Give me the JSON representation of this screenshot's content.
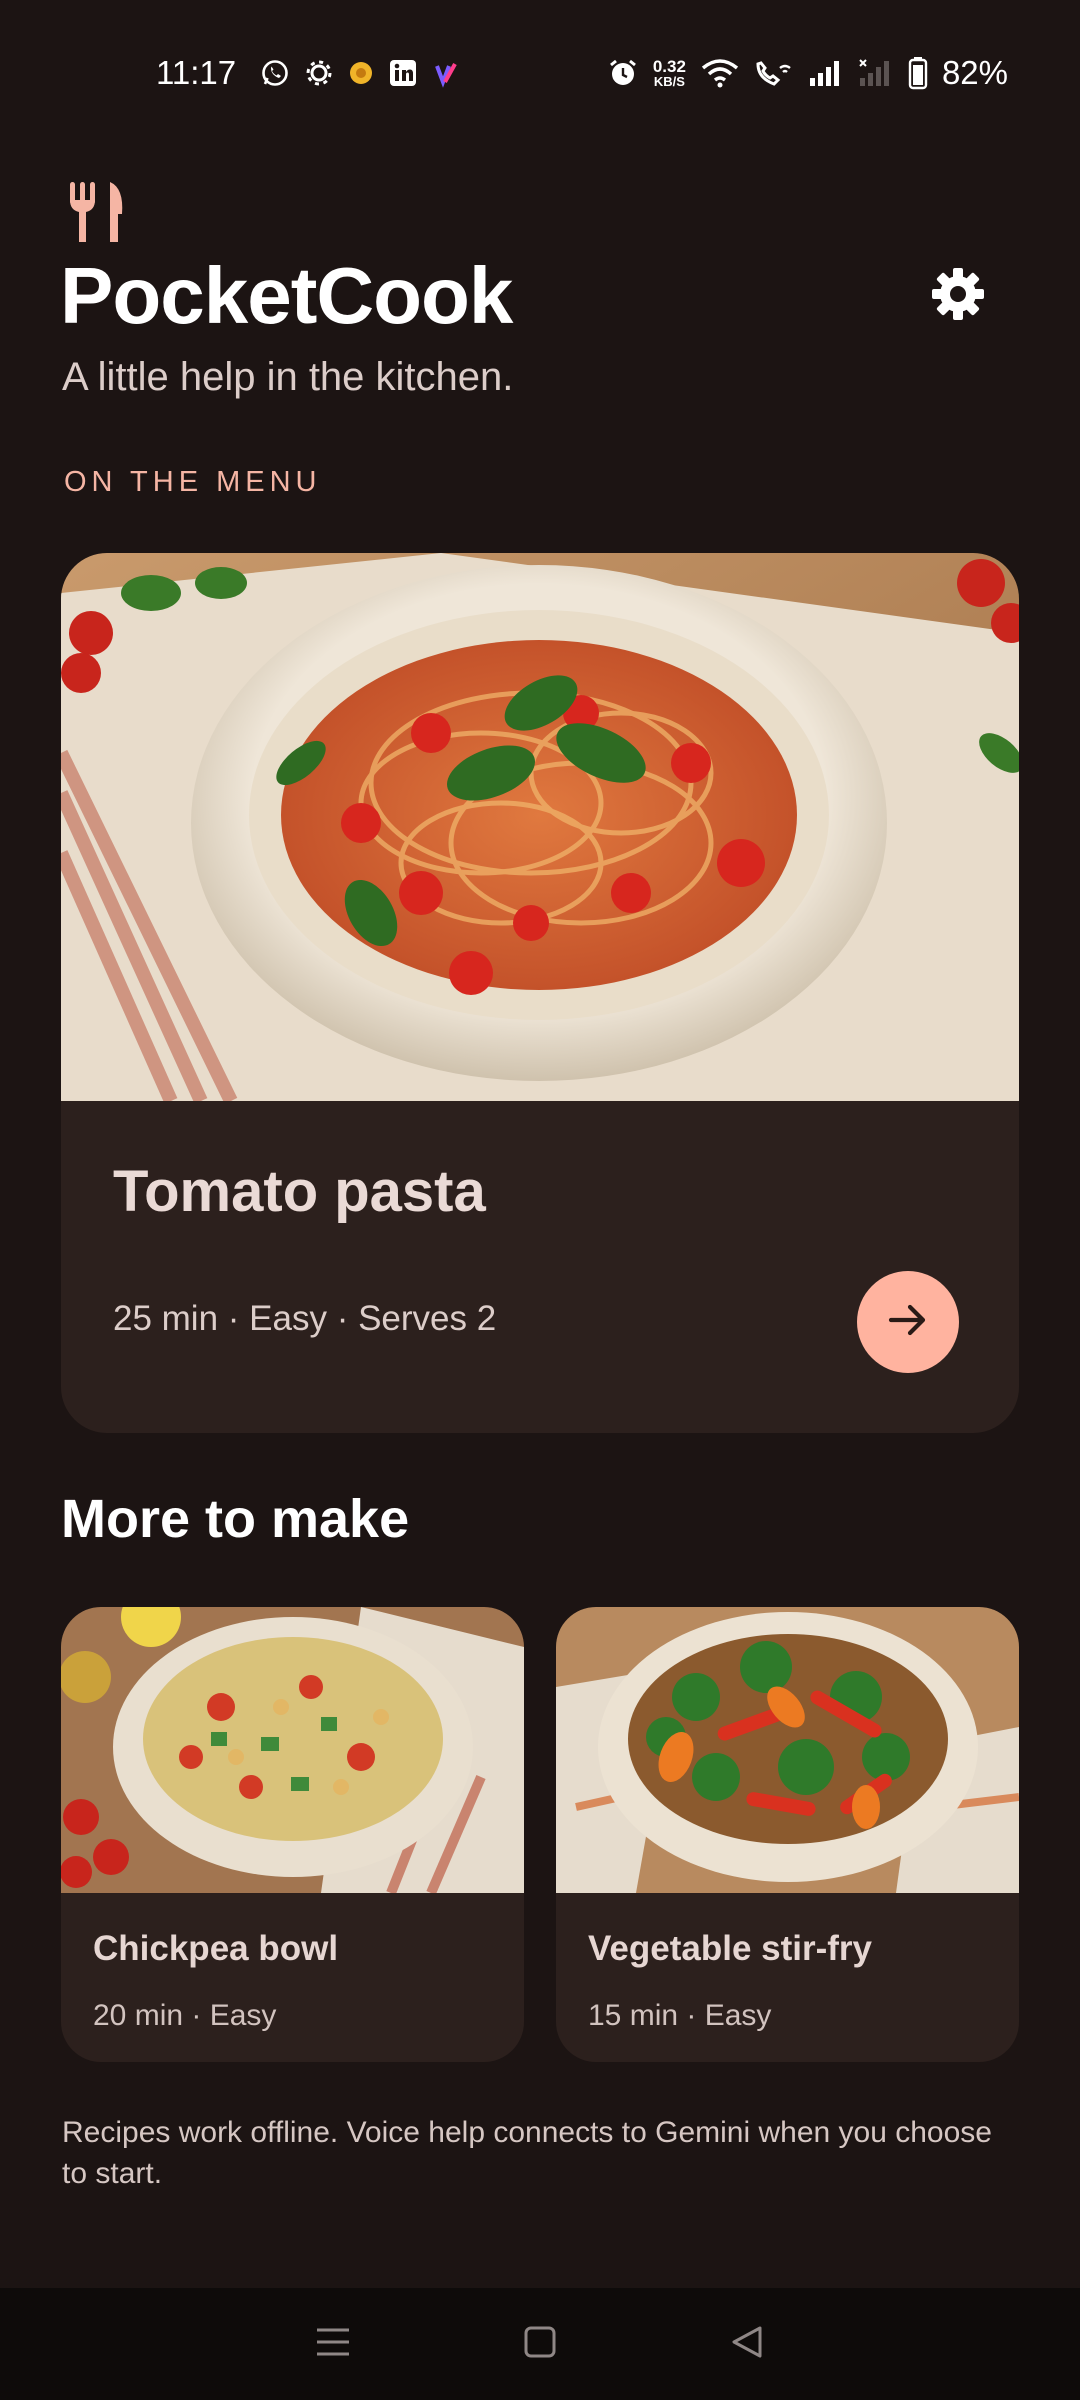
{
  "status_bar": {
    "time": "11:17",
    "net_speed_value": "0.32",
    "net_speed_unit": "KB/S",
    "battery": "82%",
    "icons": [
      "whatsapp-icon",
      "settings-gear-icon",
      "app-badge-icon",
      "linkedin-icon",
      "app-logo-icon",
      "alarm-icon",
      "wifi-icon",
      "wifi-calling-icon",
      "signal-icon",
      "signal-no-service-icon",
      "battery-icon"
    ]
  },
  "header": {
    "app_name": "PocketCook",
    "tagline": "A little help in the kitchen.",
    "icons": {
      "logo": "fork-knife-icon",
      "settings": "gear-icon"
    }
  },
  "featured": {
    "section_label": "ON THE MENU",
    "title": "Tomato pasta",
    "meta": "25 min · Easy · Serves 2",
    "image": "tomato-pasta-photo",
    "action_icon": "arrow-right-icon"
  },
  "more": {
    "heading": "More to make",
    "cards": [
      {
        "title": "Chickpea bowl",
        "meta": "20 min · Easy",
        "image": "chickpea-bowl-photo"
      },
      {
        "title": "Vegetable stir-fry",
        "meta": "15 min · Easy",
        "image": "vegetable-stir-fry-photo"
      }
    ]
  },
  "footnote": "Recipes work offline. Voice help connects to Gemini when you choose to start.",
  "nav_bar": {
    "icons": [
      "menu-icon",
      "home-icon",
      "back-icon"
    ]
  },
  "colors": {
    "background": "#1c1413",
    "card": "#2c201d",
    "accent": "#ffb39f",
    "accent_label": "#f5b5a4"
  }
}
